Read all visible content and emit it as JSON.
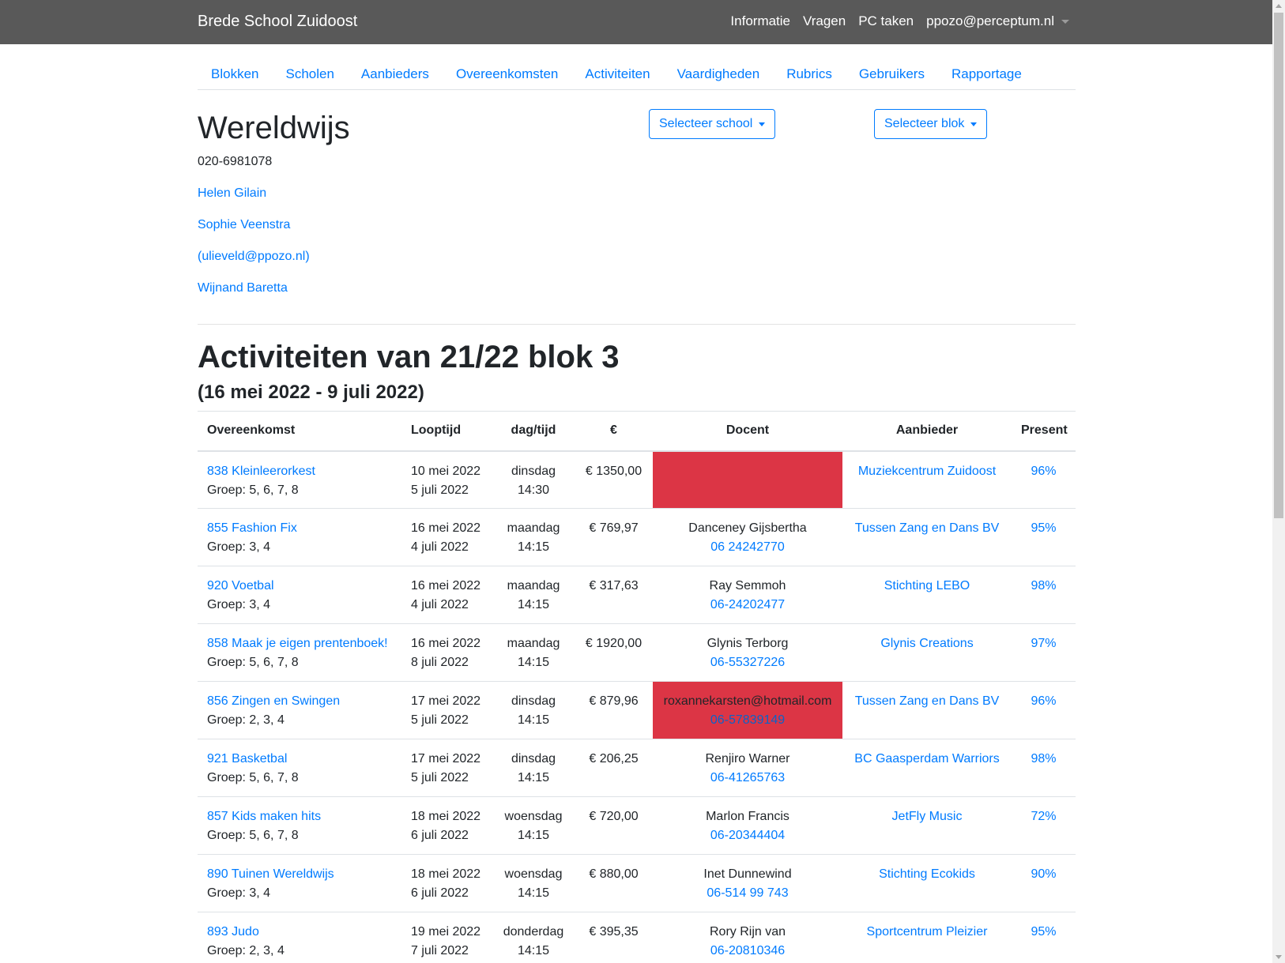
{
  "navbar": {
    "brand": "Brede School Zuidoost",
    "links": [
      "Informatie",
      "Vragen",
      "PC taken"
    ],
    "user": "ppozo@perceptum.nl"
  },
  "subnav": [
    "Blokken",
    "Scholen",
    "Aanbieders",
    "Overeenkomsten",
    "Activiteiten",
    "Vaardigheden",
    "Rubrics",
    "Gebruikers",
    "Rapportage"
  ],
  "school": {
    "name": "Wereldwijs",
    "phone": "020-6981078",
    "contacts": [
      "Helen Gilain",
      "Sophie Veenstra",
      "(ulieveld@ppozo.nl)",
      "Wijnand Baretta"
    ],
    "select_school": "Selecteer school",
    "select_block": "Selecteer blok"
  },
  "activities": {
    "title": "Activiteiten van 21/22 blok 3",
    "period": "(16 mei 2022 - 9 juli 2022)",
    "headers": [
      "Overeenkomst",
      "Looptijd",
      "dag/tijd",
      "€",
      "Docent",
      "Aanbieder",
      "Present"
    ],
    "rows": [
      {
        "name": "838 Kleinleerorkest",
        "groep": "Groep: 5, 6, 7, 8",
        "start": "10 mei 2022",
        "end": "5 juli 2022",
        "day": "dinsdag",
        "time": "14:30",
        "price": "€ 1350,00",
        "docent": "",
        "docent_phone": "",
        "docent_alert": true,
        "aanbieder": "Muziekcentrum Zuidoost",
        "present": "96%"
      },
      {
        "name": "855 Fashion Fix",
        "groep": "Groep: 3, 4",
        "start": "16 mei 2022",
        "end": "4 juli 2022",
        "day": "maandag",
        "time": "14:15",
        "price": "€ 769,97",
        "docent": "Danceney Gijsbertha",
        "docent_phone": "06 24242770",
        "docent_alert": false,
        "aanbieder": "Tussen Zang en Dans BV",
        "present": "95%"
      },
      {
        "name": "920 Voetbal",
        "groep": "Groep: 3, 4",
        "start": "16 mei 2022",
        "end": "4 juli 2022",
        "day": "maandag",
        "time": "14:15",
        "price": "€ 317,63",
        "docent": "Ray Semmoh",
        "docent_phone": "06-24202477",
        "docent_alert": false,
        "aanbieder": "Stichting LEBO",
        "present": "98%"
      },
      {
        "name": "858 Maak je eigen prentenboek!",
        "groep": "Groep: 5, 6, 7, 8",
        "start": "16 mei 2022",
        "end": "8 juli 2022",
        "day": "maandag",
        "time": "14:15",
        "price": "€ 1920,00",
        "docent": "Glynis Terborg",
        "docent_phone": "06-55327226",
        "docent_alert": false,
        "aanbieder": "Glynis Creations",
        "present": "97%"
      },
      {
        "name": "856 Zingen en Swingen",
        "groep": "Groep: 2, 3, 4",
        "start": "17 mei 2022",
        "end": "5 juli 2022",
        "day": "dinsdag",
        "time": "14:15",
        "price": "€ 879,96",
        "docent": "roxannekarsten@hotmail.com",
        "docent_phone": "06-57839149",
        "docent_alert": true,
        "aanbieder": "Tussen Zang en Dans BV",
        "present": "96%"
      },
      {
        "name": "921 Basketbal",
        "groep": "Groep: 5, 6, 7, 8",
        "start": "17 mei 2022",
        "end": "5 juli 2022",
        "day": "dinsdag",
        "time": "14:15",
        "price": "€ 206,25",
        "docent": "Renjiro Warner",
        "docent_phone": "06-41265763",
        "docent_alert": false,
        "aanbieder": "BC Gaasperdam Warriors",
        "present": "98%"
      },
      {
        "name": "857 Kids maken hits",
        "groep": "Groep: 5, 6, 7, 8",
        "start": "18 mei 2022",
        "end": "6 juli 2022",
        "day": "woensdag",
        "time": "14:15",
        "price": "€ 720,00",
        "docent": "Marlon Francis",
        "docent_phone": "06-20344404",
        "docent_alert": false,
        "aanbieder": "JetFly Music",
        "present": "72%"
      },
      {
        "name": "890 Tuinen Wereldwijs",
        "groep": "Groep: 3, 4",
        "start": "18 mei 2022",
        "end": "6 juli 2022",
        "day": "woensdag",
        "time": "14:15",
        "price": "€ 880,00",
        "docent": "Inet Dunnewind",
        "docent_phone": "06-514 99 743",
        "docent_alert": false,
        "aanbieder": "Stichting Ecokids",
        "present": "90%"
      },
      {
        "name": "893 Judo",
        "groep": "Groep: 2, 3, 4",
        "start": "19 mei 2022",
        "end": "7 juli 2022",
        "day": "donderdag",
        "time": "14:15",
        "price": "€ 395,35",
        "docent": "Rory Rijn van",
        "docent_phone": "06-20810346",
        "docent_alert": false,
        "aanbieder": "Sportcentrum Pleizier",
        "present": "95%"
      }
    ]
  }
}
